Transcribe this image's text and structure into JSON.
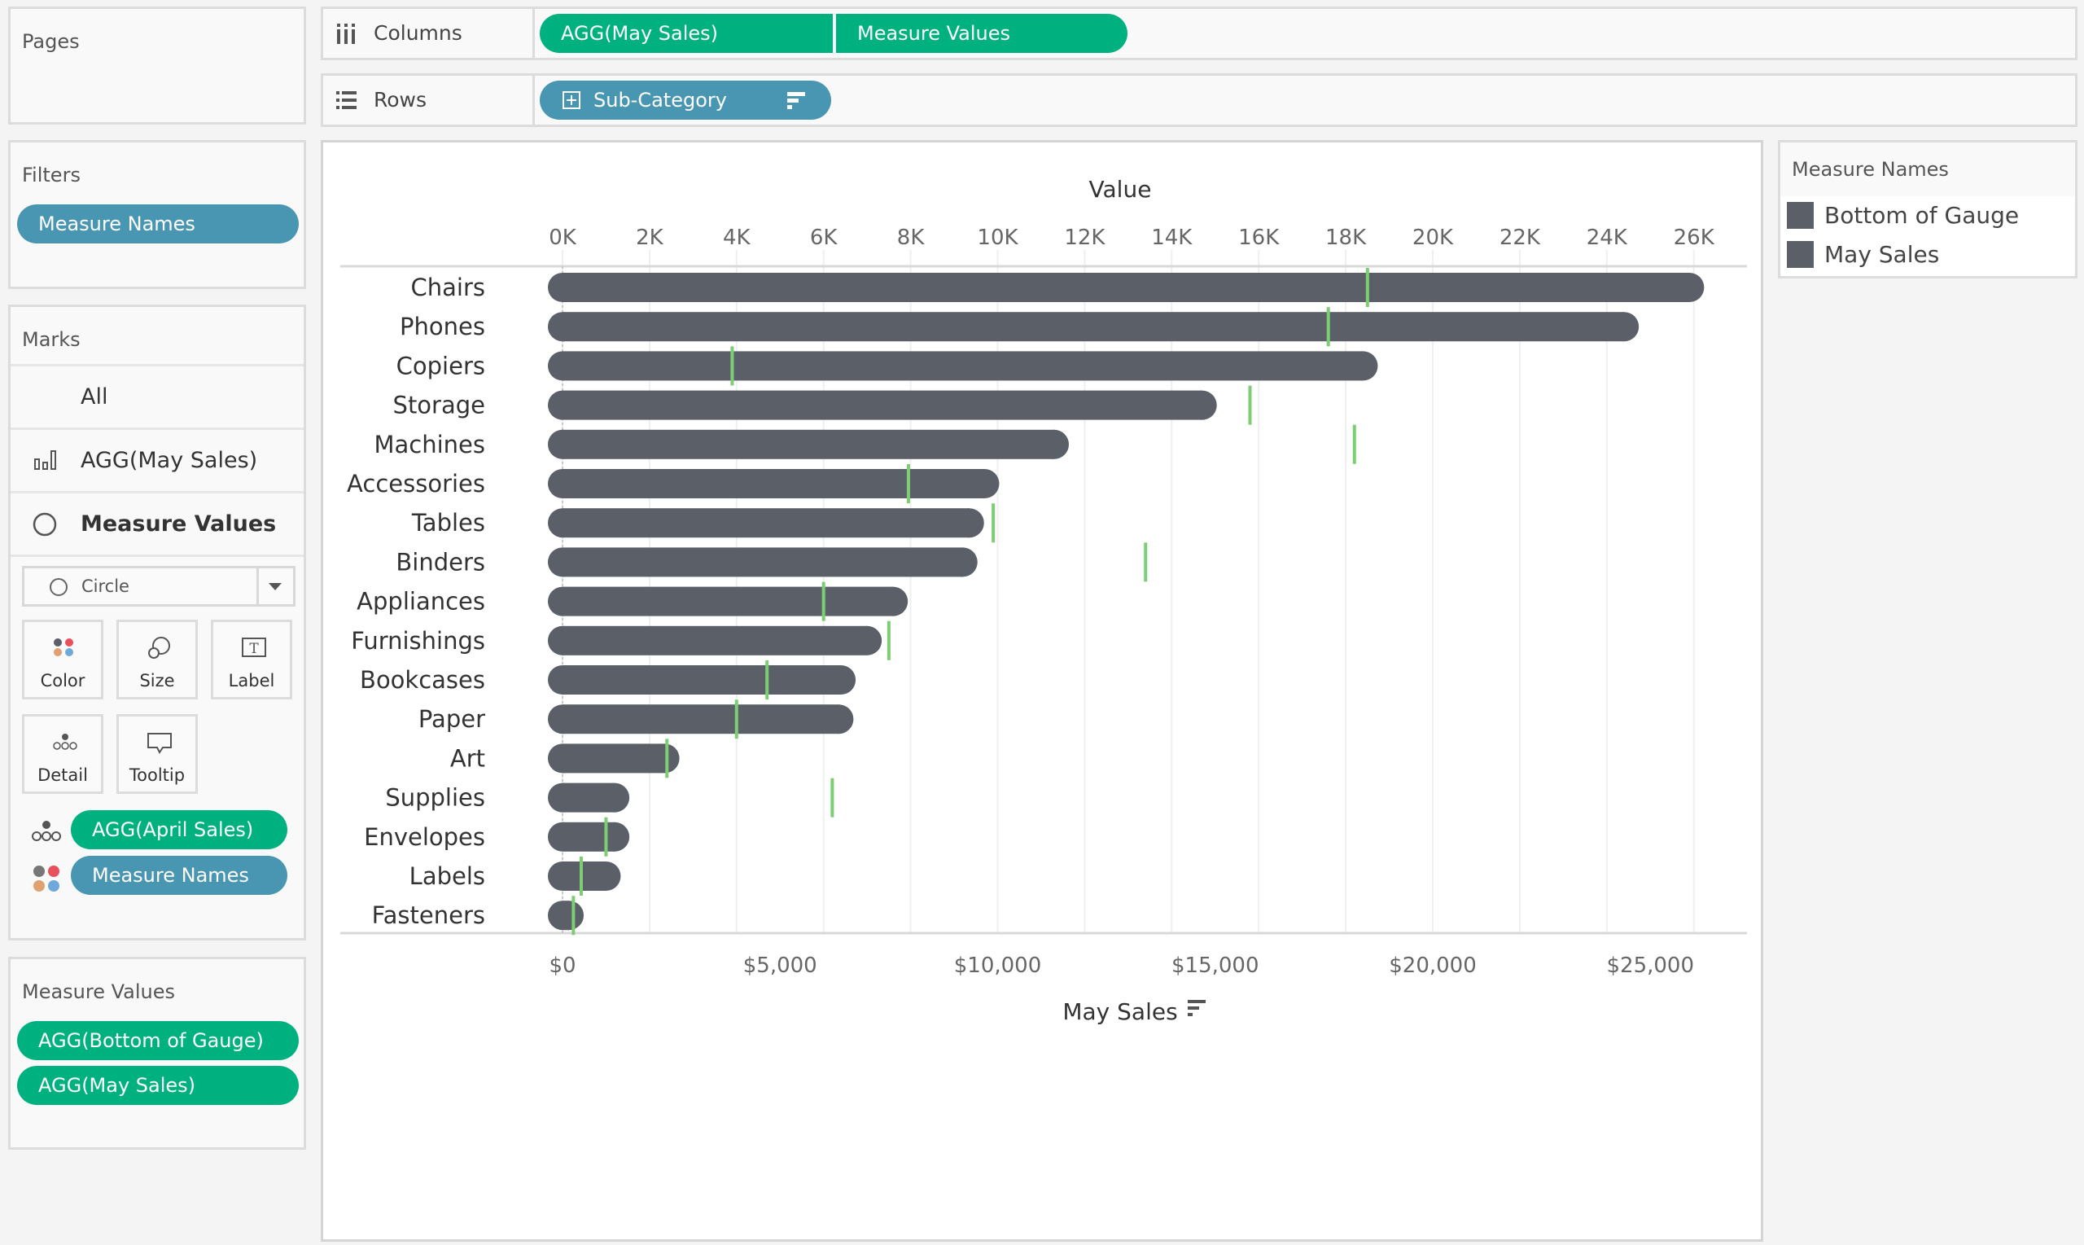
{
  "pages": {
    "title": "Pages"
  },
  "shelves": {
    "columns": {
      "label": "Columns",
      "pills": [
        "AGG(May Sales)",
        "Measure Values"
      ]
    },
    "rows": {
      "label": "Rows",
      "pills": [
        "Sub-Category"
      ]
    }
  },
  "filters": {
    "title": "Filters",
    "pills": [
      "Measure Names"
    ]
  },
  "marks": {
    "title": "Marks",
    "cards": [
      "All",
      "AGG(May Sales)",
      "Measure Values"
    ],
    "mark_type": "Circle",
    "buttons": [
      "Color",
      "Size",
      "Label",
      "Detail",
      "Tooltip"
    ],
    "fields": [
      {
        "icon": "detail-icon",
        "label": "AGG(April Sales)",
        "color": "#00b180"
      },
      {
        "icon": "color-icon",
        "label": "Measure Names",
        "color": "#4996b2"
      }
    ]
  },
  "measure_values": {
    "title": "Measure Values",
    "pills": [
      "AGG(Bottom of Gauge)",
      "AGG(May Sales)"
    ]
  },
  "legend": {
    "title": "Measure Names",
    "items": [
      {
        "label": "Bottom of Gauge",
        "color": "#5b5f68"
      },
      {
        "label": "May Sales",
        "color": "#5b5f68"
      }
    ]
  },
  "chart_data": {
    "type": "bar",
    "top_axis": {
      "title": "Value",
      "ticks": [
        "0K",
        "2K",
        "4K",
        "6K",
        "8K",
        "10K",
        "12K",
        "14K",
        "16K",
        "18K",
        "20K",
        "22K",
        "24K",
        "26K"
      ],
      "range": [
        0,
        26000
      ]
    },
    "bottom_axis": {
      "title": "May Sales",
      "ticks": [
        "$0",
        "$5,000",
        "$10,000",
        "$15,000",
        "$20,000",
        "$25,000"
      ],
      "range": [
        0,
        25000
      ]
    },
    "categories": [
      "Chairs",
      "Phones",
      "Copiers",
      "Storage",
      "Machines",
      "Accessories",
      "Tables",
      "Binders",
      "Appliances",
      "Furnishings",
      "Bookcases",
      "Paper",
      "Art",
      "Supplies",
      "Envelopes",
      "Labels",
      "Fasteners"
    ],
    "series": [
      {
        "name": "May Sales",
        "color": "#5b5f68",
        "values": [
          25900,
          24400,
          18400,
          14700,
          11300,
          9700,
          9350,
          9200,
          7600,
          7000,
          6400,
          6350,
          2350,
          1200,
          1200,
          1000,
          150
        ]
      },
      {
        "name": "Bottom of Gauge",
        "color": "#5b5f68",
        "values": [
          0,
          0,
          0,
          0,
          0,
          0,
          0,
          0,
          0,
          0,
          0,
          0,
          0,
          0,
          0,
          0,
          0
        ]
      },
      {
        "name": "AGG(April Sales)",
        "color": "#7dcd74",
        "values": [
          18500,
          17600,
          3900,
          15800,
          18200,
          7950,
          9900,
          13400,
          6000,
          7500,
          4700,
          4000,
          2400,
          6200,
          1000,
          430,
          250
        ]
      }
    ],
    "grid": true
  }
}
